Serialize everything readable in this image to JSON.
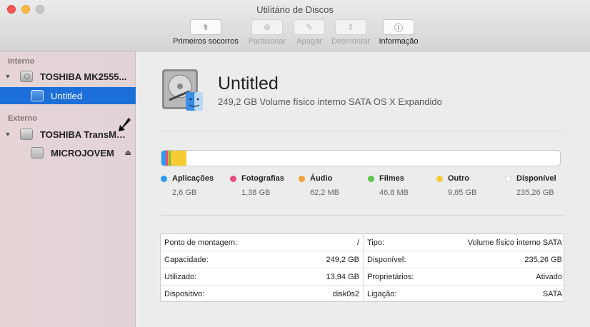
{
  "window": {
    "title": "Utilitário de Discos"
  },
  "toolbar": {
    "items": [
      {
        "label": "Primeiros socorros",
        "icon": "stethoscope-icon",
        "glyph": "⚕",
        "enabled": true
      },
      {
        "label": "Particionar",
        "icon": "partition-icon",
        "glyph": "⊕",
        "enabled": false
      },
      {
        "label": "Apagar",
        "icon": "erase-icon",
        "glyph": "✎",
        "enabled": false
      },
      {
        "label": "Desmontar",
        "icon": "unmount-icon",
        "glyph": "⇕",
        "enabled": false
      },
      {
        "label": "Informação",
        "icon": "info-icon",
        "glyph": "ⓘ",
        "enabled": true
      }
    ]
  },
  "sidebar": {
    "internal_header": "Interno",
    "external_header": "Externo",
    "internal_disk": "TOSHIBA MK2555...",
    "internal_volume": "Untitled",
    "external_disk": "TOSHIBA TransMe...",
    "external_volume": "MICROJOVEM",
    "eject_glyph": "⏏",
    "disclosure_glyph": "▼"
  },
  "detail": {
    "name": "Untitled",
    "description": "249,2 GB Volume físico interno SATA OS X Expandido"
  },
  "usage": {
    "bar_total_gb": 249.2,
    "categories": [
      {
        "name": "Aplicações",
        "size": "2,6 GB",
        "gb": 2.6,
        "color": "#2d9cf0"
      },
      {
        "name": "Fotografias",
        "size": "1,38 GB",
        "gb": 1.38,
        "color": "#e94f7a"
      },
      {
        "name": "Áudio",
        "size": "62,2 MB",
        "gb": 0.0622,
        "color": "#f2a03a"
      },
      {
        "name": "Filmes",
        "size": "46,8 MB",
        "gb": 0.0468,
        "color": "#5cc94a"
      },
      {
        "name": "Outro",
        "size": "9,85 GB",
        "gb": 9.85,
        "color": "#f7cc33"
      },
      {
        "name": "Disponível",
        "size": "235,26 GB",
        "gb": 235.26,
        "color": "#ffffff"
      }
    ]
  },
  "info": {
    "left": [
      {
        "label": "Ponto de montagem:",
        "value": "/"
      },
      {
        "label": "Capacidade:",
        "value": "249,2 GB"
      },
      {
        "label": "Utilizado:",
        "value": "13,94 GB"
      },
      {
        "label": "Dispositivo:",
        "value": "disk0s2"
      }
    ],
    "right": [
      {
        "label": "Tipo:",
        "value": "Volume físico interno SATA"
      },
      {
        "label": "Disponível:",
        "value": "235,26 GB"
      },
      {
        "label": "Proprietários:",
        "value": "Ativado"
      },
      {
        "label": "Ligação:",
        "value": "SATA"
      }
    ]
  }
}
